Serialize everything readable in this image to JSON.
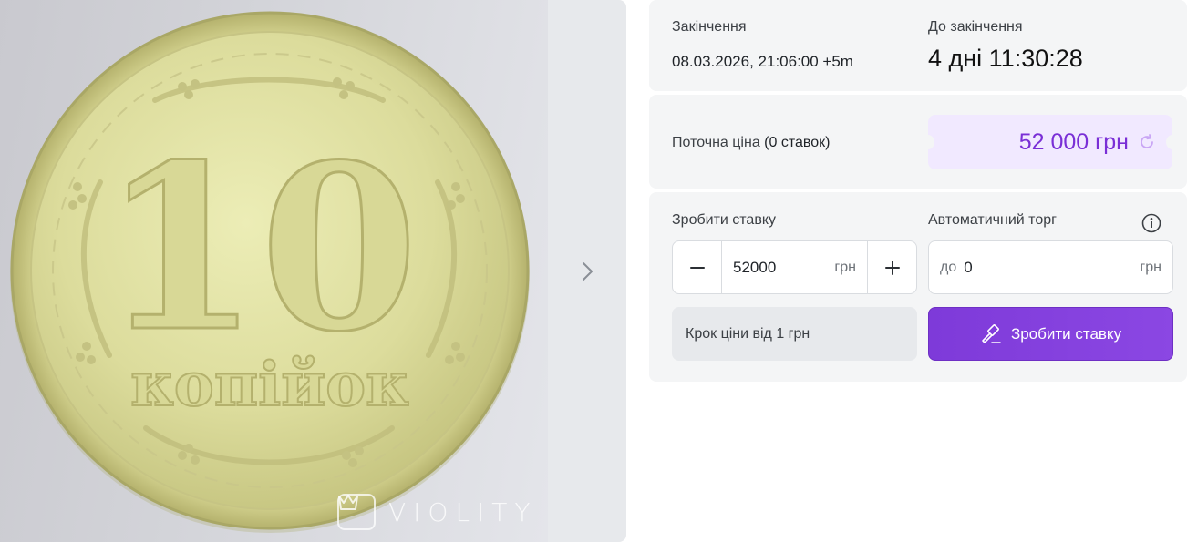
{
  "photo": {
    "alt": "10 копійок",
    "watermark": "VIOLITY",
    "coin_denomination": "10",
    "coin_word": "копійок"
  },
  "gallery": {
    "next_icon": "chevron-right-icon"
  },
  "timer": {
    "end_label": "Закінчення",
    "end_value": "08.03.2026, 21:06:00 +5m",
    "left_label": "До закінчення",
    "left_value": "4 дні 11:30:28"
  },
  "price": {
    "label": "Поточна ціна",
    "bids": "(0 ставок)",
    "value": "52 000 грн",
    "refresh_icon": "refresh-icon"
  },
  "bid": {
    "label": "Зробити ставку",
    "amount": "52000",
    "unit": "грн",
    "minus_icon": "minus-icon",
    "plus_icon": "plus-icon",
    "step_info": "Крок ціни від 1 грн",
    "button_label": "Зробити ставку",
    "button_icon": "gavel-icon"
  },
  "auto": {
    "label": "Автоматичний торг",
    "prefix": "до",
    "value": "0",
    "unit": "грн",
    "info_icon": "info-icon"
  },
  "colors": {
    "accent": "#7e3ad9",
    "price_bg": "#f1e9ff",
    "card_bg": "#f4f5f6"
  }
}
